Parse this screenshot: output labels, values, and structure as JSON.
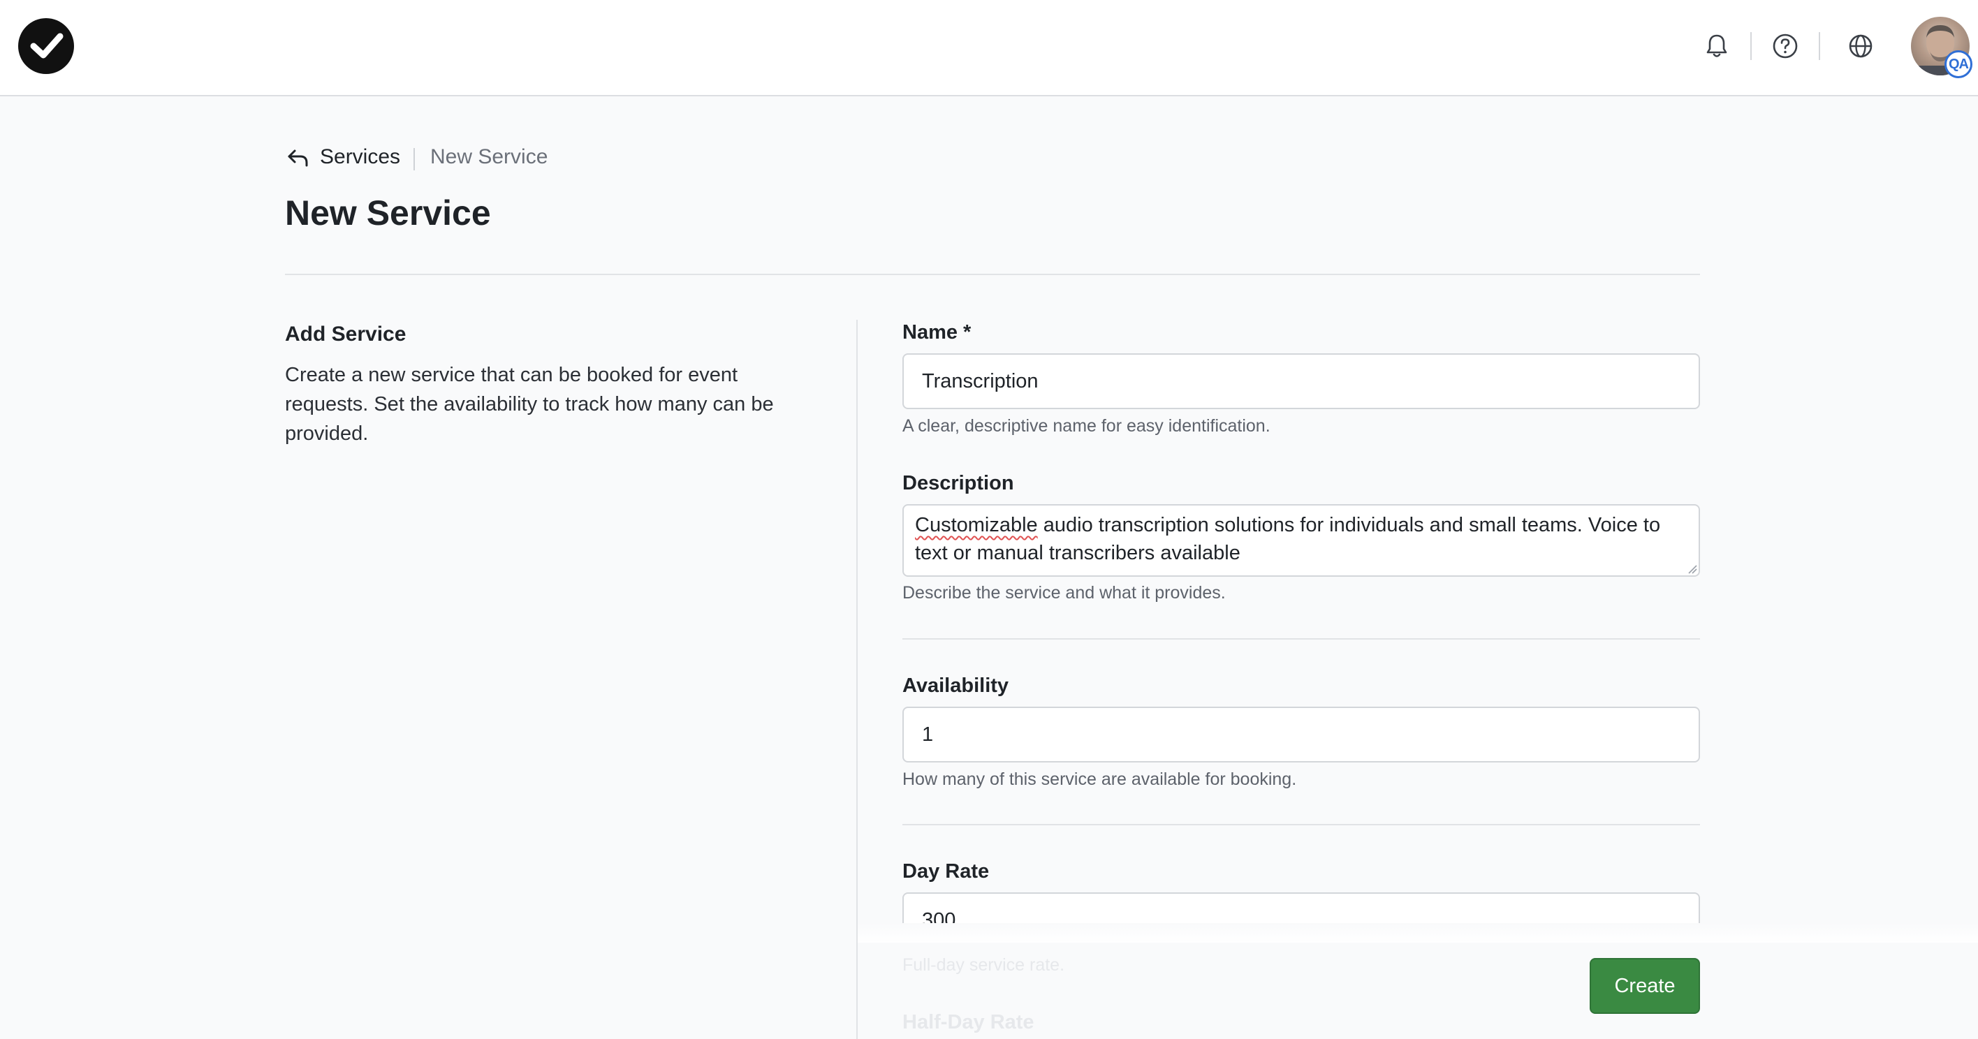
{
  "header": {
    "logo_icon": "check-circle-logo-icon",
    "notifications_icon": "bell-icon",
    "help_icon": "question-circle-icon",
    "language_icon": "globe-icon",
    "avatar_badge": "QA"
  },
  "breadcrumb": {
    "back_icon": "reply-arrow-icon",
    "parent": "Services",
    "current": "New Service"
  },
  "page": {
    "title": "New Service"
  },
  "section": {
    "title": "Add Service",
    "description": "Create a new service that can be booked for event requests. Set the availability to track how many can be provided."
  },
  "form": {
    "name": {
      "label": "Name *",
      "value": "Transcription",
      "help": "A clear, descriptive name for easy identification."
    },
    "description": {
      "label": "Description",
      "misspelled_word": "Customizable",
      "value_rest": " audio transcription solutions for individuals and small teams. Voice to text or manual transcribers available",
      "help": "Describe the service and what it provides."
    },
    "availability": {
      "label": "Availability",
      "value": "1",
      "help": "How many of this service are available for booking."
    },
    "day_rate": {
      "label": "Day Rate",
      "value": "300",
      "help": "Full-day service rate."
    },
    "half_day_rate": {
      "label": "Half-Day Rate"
    }
  },
  "actions": {
    "create_label": "Create",
    "create_color": "#3a8a42"
  }
}
